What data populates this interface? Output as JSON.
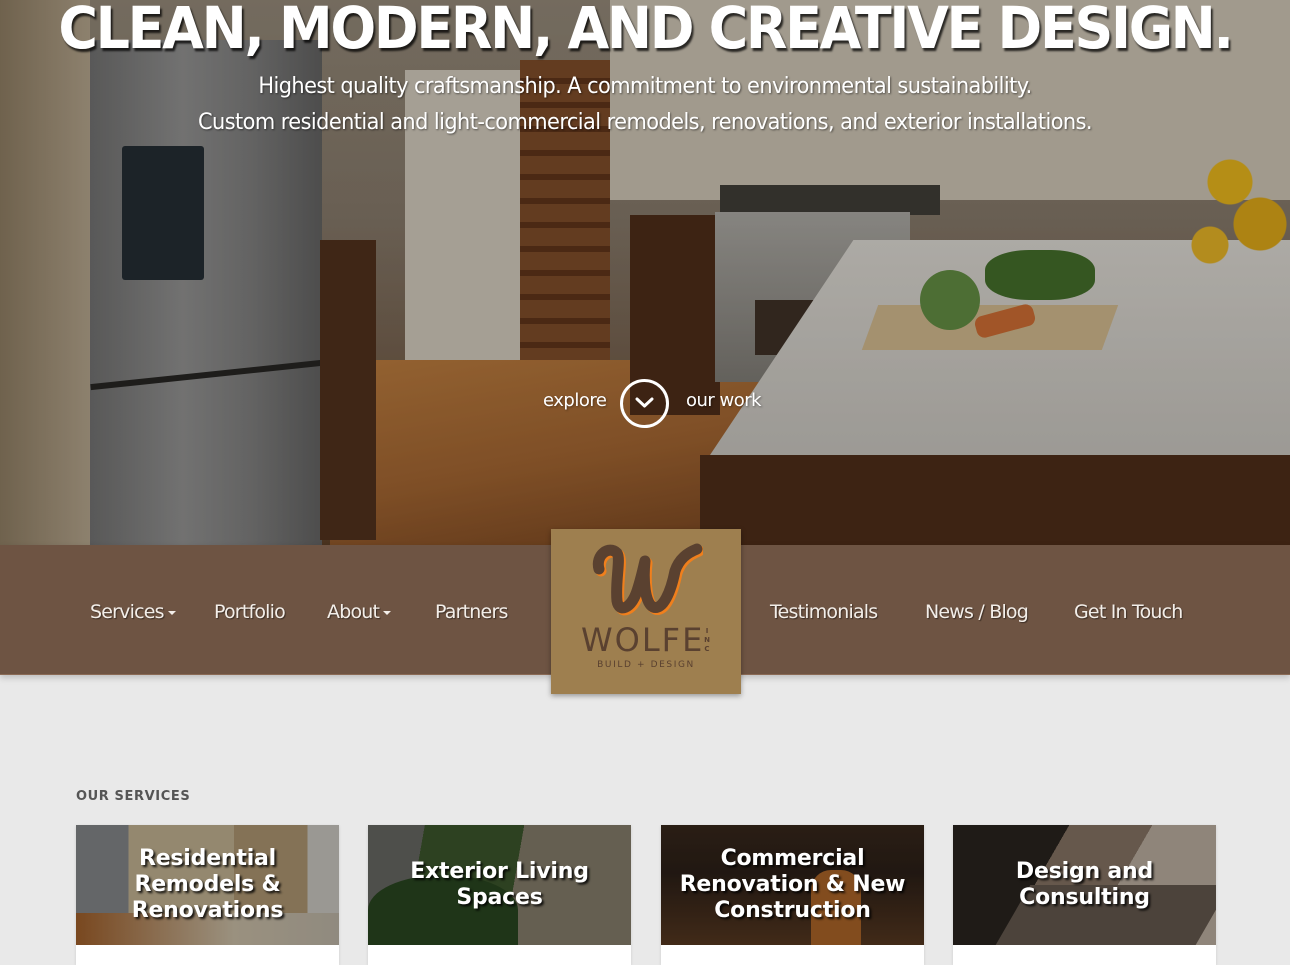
{
  "hero": {
    "title": "CLEAN, MODERN, AND CREATIVE DESIGN.",
    "subtitle_line1": "Highest quality craftsmanship. A commitment to environmental sustainability.",
    "subtitle_line2": "Custom residential and light-commercial remodels, renovations, and exterior installations.",
    "explore_left": "explore",
    "explore_right": "our work",
    "explore_icon": "chevron-down-icon"
  },
  "nav": {
    "left_items": [
      {
        "label": "Services",
        "has_dropdown": true
      },
      {
        "label": "Portfolio",
        "has_dropdown": false
      },
      {
        "label": "About",
        "has_dropdown": true
      },
      {
        "label": "Partners",
        "has_dropdown": false
      }
    ],
    "right_items": [
      {
        "label": "Testimonials",
        "has_dropdown": false
      },
      {
        "label": "News / Blog",
        "has_dropdown": false
      },
      {
        "label": "Get In Touch",
        "has_dropdown": false
      }
    ]
  },
  "logo": {
    "monogram": "W",
    "name": "WOLFE",
    "suffix": "INC",
    "tagline": "BUILD + DESIGN"
  },
  "services": {
    "heading": "OUR SERVICES",
    "cards": [
      {
        "title": "Residential Remodels & Renovations"
      },
      {
        "title": "Exterior Living Spaces"
      },
      {
        "title": "Commercial Renovation & New Construction"
      },
      {
        "title": "Design and Consulting"
      }
    ]
  },
  "colors": {
    "nav_bg": "#6e5443",
    "logo_bg": "#9e7f4f",
    "logo_text": "#5a4130",
    "logo_accent": "#f07f1c",
    "page_bg": "#e9e9e9"
  }
}
